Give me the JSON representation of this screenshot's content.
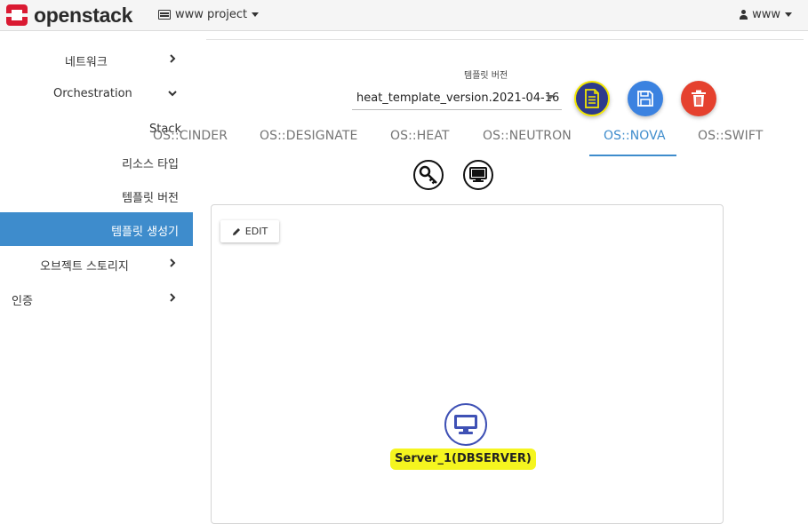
{
  "topbar": {
    "logo_text": "openstack",
    "project_label": "www project",
    "user_label": "www"
  },
  "sidebar": {
    "items": [
      {
        "label": "네트워크",
        "expanded": false
      },
      {
        "label": "Orchestration",
        "expanded": true
      },
      {
        "label": "Stack"
      },
      {
        "label": "리소스 타입"
      },
      {
        "label": "템플릿 버전"
      },
      {
        "label": "템플릿 생성기",
        "active": true
      },
      {
        "label": "오브젝트 스토리지",
        "expanded": false
      },
      {
        "label": "인증",
        "expanded": false
      }
    ]
  },
  "template": {
    "version_label": "템플릿 버전",
    "version_value": "heat_template_version.2021-04-16"
  },
  "actions": {
    "doc_icon": "document-icon",
    "save_icon": "save-icon",
    "delete_icon": "trash-icon"
  },
  "tabs": [
    {
      "label": "OS::CINDER"
    },
    {
      "label": "OS::DESIGNATE"
    },
    {
      "label": "OS::HEAT"
    },
    {
      "label": "OS::NEUTRON"
    },
    {
      "label": "OS::NOVA",
      "active": true
    },
    {
      "label": "OS::SWIFT"
    }
  ],
  "resources": [
    "key-icon",
    "server-icon"
  ],
  "canvas": {
    "edit_label": "EDIT",
    "node_label": "Server_1(DBSERVER)"
  },
  "colors": {
    "accent": "#3e8ccc",
    "save": "#3b82e0",
    "delete": "#e5412e",
    "doc": "#2d3a8c",
    "highlight": "#f5f51f",
    "node_border": "#3f51b5",
    "logo_red": "#da1a32"
  }
}
